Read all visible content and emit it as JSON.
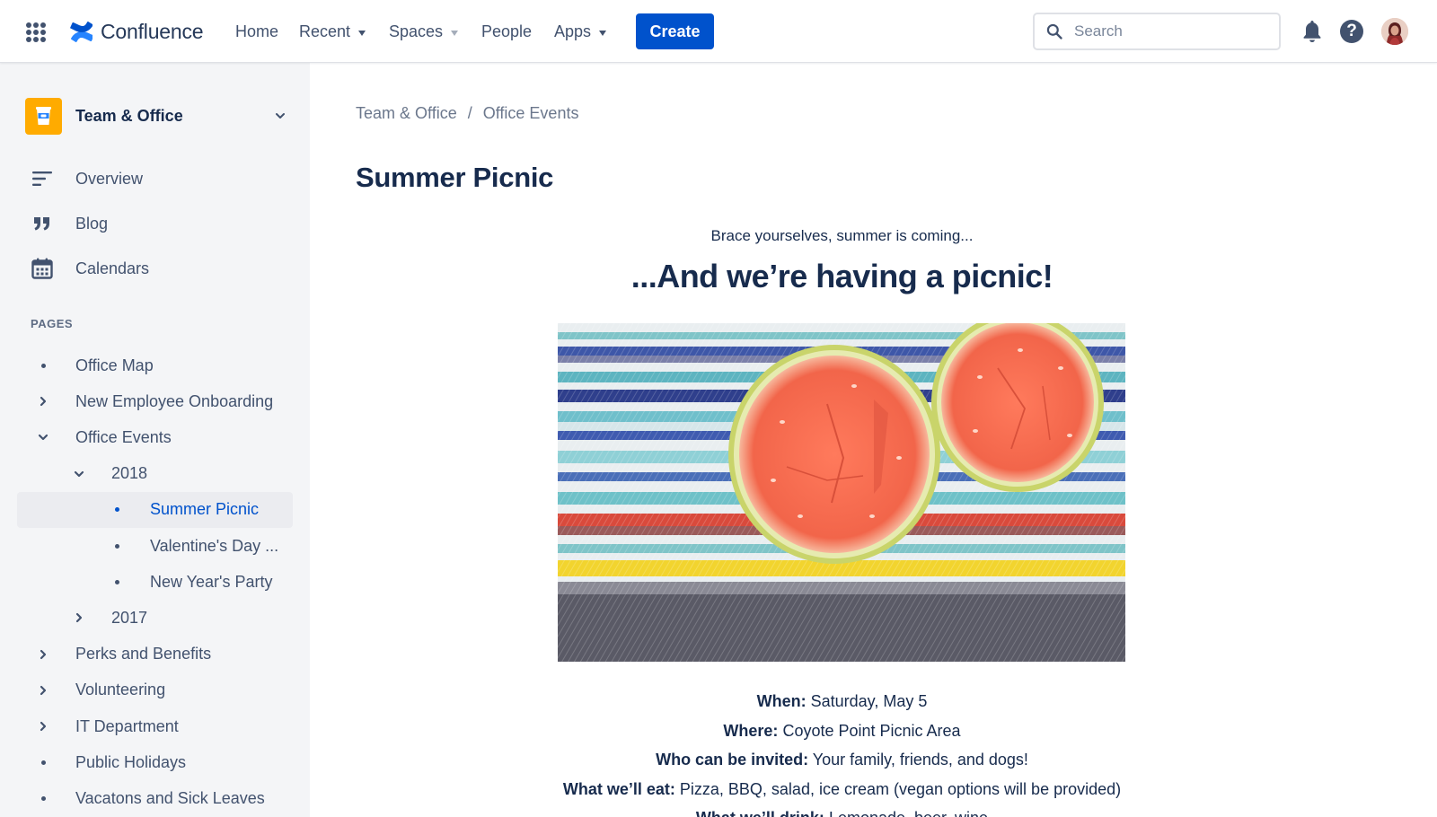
{
  "topnav": {
    "brand": "Confluence",
    "items": [
      {
        "label": "Home",
        "has_caret": false
      },
      {
        "label": "Recent",
        "has_caret": true
      },
      {
        "label": "Spaces",
        "has_caret": true
      },
      {
        "label": "People",
        "has_caret": false
      },
      {
        "label": "Apps",
        "has_caret": true
      }
    ],
    "create_label": "Create",
    "search_placeholder": "Search",
    "help_glyph": "?",
    "accent": "#0052CC"
  },
  "sidebar": {
    "space_name": "Team & Office",
    "links": [
      {
        "label": "Overview",
        "icon": "overview-icon"
      },
      {
        "label": "Blog",
        "icon": "quote-icon"
      },
      {
        "label": "Calendars",
        "icon": "calendar-icon"
      }
    ],
    "section_title": "PAGES",
    "tree": [
      {
        "label": "Office Map",
        "marker": "bullet",
        "depth": 0
      },
      {
        "label": "New Employee Onboarding",
        "marker": "chevron-right",
        "depth": 0
      },
      {
        "label": "Office Events",
        "marker": "chevron-down",
        "depth": 0
      },
      {
        "label": "2018",
        "marker": "chevron-down",
        "depth": 1
      },
      {
        "label": "Summer Picnic",
        "marker": "bullet",
        "depth": 2,
        "selected": true
      },
      {
        "label": "Valentine's Day ...",
        "marker": "bullet",
        "depth": 2
      },
      {
        "label": "New Year's Party",
        "marker": "bullet",
        "depth": 2
      },
      {
        "label": "2017",
        "marker": "chevron-right",
        "depth": 1
      },
      {
        "label": "Perks and Benefits",
        "marker": "chevron-right",
        "depth": 0
      },
      {
        "label": "Volunteering",
        "marker": "chevron-right",
        "depth": 0
      },
      {
        "label": "IT Department",
        "marker": "chevron-right",
        "depth": 0
      },
      {
        "label": "Public Holidays",
        "marker": "bullet",
        "depth": 0
      },
      {
        "label": "Vacatons and Sick Leaves",
        "marker": "bullet",
        "depth": 0
      }
    ]
  },
  "main": {
    "breadcrumb": [
      "Team & Office",
      "Office Events"
    ],
    "breadcrumb_separator": "/",
    "title": "Summer Picnic",
    "tagline": "Brace yourselves, summer is coming...",
    "headline": "...And we’re having a picnic!",
    "details": [
      {
        "key": "When:",
        "value": "Saturday, May 5"
      },
      {
        "key": "Where:",
        "value": "Coyote Point Picnic Area"
      },
      {
        "key": "Who can be invited:",
        "value": "Your family, friends, and dogs!"
      },
      {
        "key": "What we’ll eat:",
        "value": "Pizza, BBQ, salad, ice cream (vegan options will be provided)"
      },
      {
        "key": "What we’ll drink:",
        "value": "Lemonade, beer, wine"
      }
    ]
  }
}
